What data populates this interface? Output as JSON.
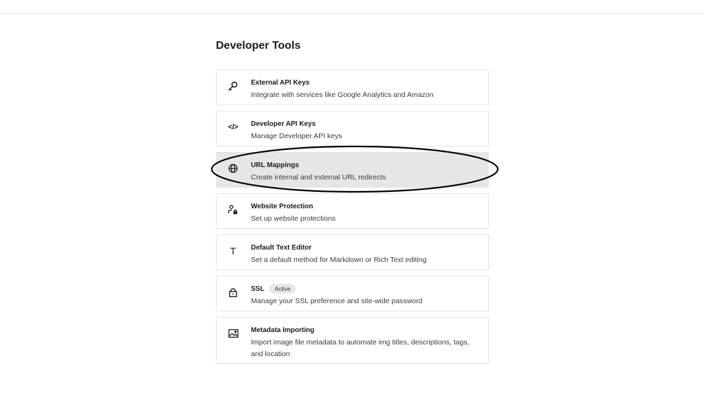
{
  "page_title": "Developer Tools",
  "items": [
    {
      "icon": "key-icon",
      "title": "External API Keys",
      "description": "Integrate with services like Google Analytics and Amazon"
    },
    {
      "icon": "code-icon",
      "title": "Developer API Keys",
      "description": "Manage Developer API keys"
    },
    {
      "icon": "globe-icon",
      "title": "URL Mappings",
      "description": "Create internal and external URL redirects"
    },
    {
      "icon": "user-lock-icon",
      "title": "Website Protection",
      "description": "Set up website protections"
    },
    {
      "icon": "text-t-icon",
      "title": "Default Text Editor",
      "description": "Set a default method for Markdown or Rich Text editing"
    },
    {
      "icon": "lock-icon",
      "title": "SSL",
      "badge": "Active",
      "description": "Manage your SSL preference and site-wide password"
    },
    {
      "icon": "image-icon",
      "title": "Metadata Importing",
      "description": "Import image file metadata to automate img titles, descriptions, tags, and location"
    }
  ],
  "code_icon_glyph": "</>",
  "text_icon_glyph": "T",
  "highlight_color": "#e6e6e6",
  "annotation_color": "#000000"
}
